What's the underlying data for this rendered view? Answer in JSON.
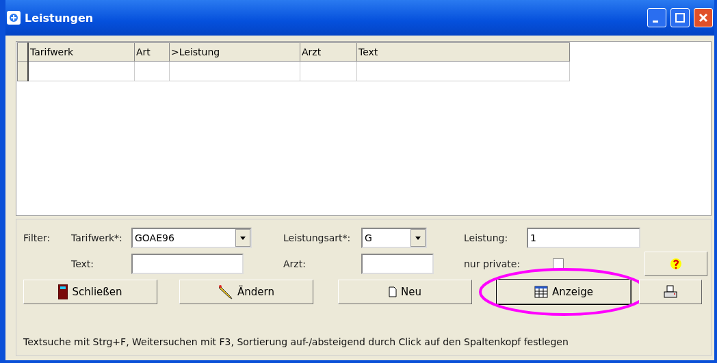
{
  "window": {
    "title": "Leistungen"
  },
  "table": {
    "columns": [
      "Tarifwerk",
      "Art",
      ">Leistung",
      "Arzt",
      "Text"
    ],
    "rows": [
      [
        "",
        "",
        "",
        "",
        ""
      ]
    ]
  },
  "filter": {
    "label": "Filter:",
    "tarifwerk": {
      "label": "Tarifwerk*:",
      "value": "GOAE96"
    },
    "leistungsart": {
      "label": "Leistungsart*:",
      "value": "G"
    },
    "leistung": {
      "label": "Leistung:",
      "value": "1"
    },
    "text": {
      "label": "Text:"
    },
    "arzt": {
      "label": "Arzt:"
    },
    "nur_private": {
      "label": "nur private:",
      "checked": false
    }
  },
  "buttons": [
    {
      "kind": "close",
      "label": "Schließen",
      "annotated": false
    },
    {
      "kind": "edit",
      "label": "Ändern",
      "annotated": false
    },
    {
      "kind": "new",
      "label": "Neu",
      "annotated": false
    },
    {
      "kind": "view",
      "label": "Anzeige",
      "annotated": true
    },
    {
      "kind": "print",
      "annotated": false
    }
  ],
  "status_bar": "Textsuche mit Strg+F, Weitersuchen mit F3, Sortierung auf-/absteigend durch Click auf den Spaltenkopf festlegen"
}
